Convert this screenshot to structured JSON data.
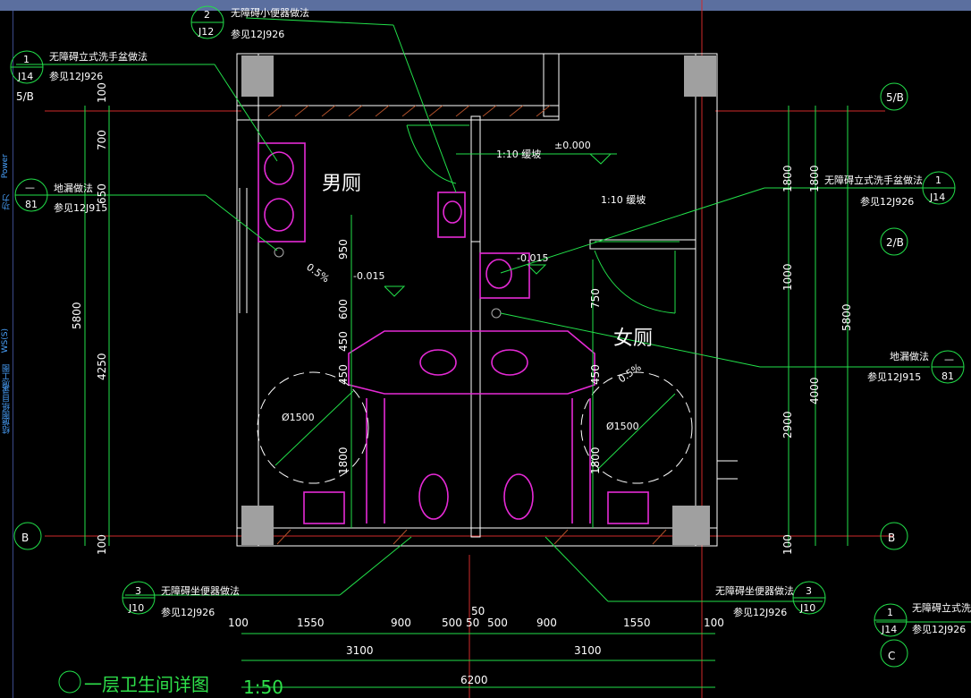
{
  "title": "一层卫生间详图",
  "scale": "1:50",
  "sidebar": {
    "labels": [
      "Power",
      "功力",
      "WS(S)",
      "施工图",
      "图纸目录",
      "结施"
    ]
  },
  "rooms": {
    "men": "男厕",
    "women": "女厕"
  },
  "grid_labels": {
    "left_b": "B",
    "right_b": "B",
    "right_5b_top": "5/B",
    "right_2b": "2/B",
    "right_c": "C",
    "left_5b": "5/B"
  },
  "callouts": {
    "urinal": {
      "num": "2",
      "ref": "J12",
      "title": "无障碍小便器做法",
      "see": "参见12J926"
    },
    "washbasin_left": {
      "num": "1",
      "ref": "J14",
      "title": "无障碍立式洗手盆做法",
      "see": "参见12J926"
    },
    "drain_left": {
      "num": "—",
      "ref": "81",
      "title": "地漏做法",
      "see": "参见12J915"
    },
    "washbasin_right": {
      "num": "1",
      "ref": "J14",
      "title": "无障碍立式洗手盆做法",
      "see": "参见12J926"
    },
    "drain_right": {
      "num": "—",
      "ref": "81",
      "title": "地漏做法",
      "see": "参见12J915"
    },
    "toilet_left": {
      "num": "3",
      "ref": "J10",
      "title": "无障碍坐便器做法",
      "see": "参见12J926"
    },
    "toilet_right": {
      "num": "3",
      "ref": "J10",
      "title": "无障碍坐便器做法",
      "see": "参见12J926"
    },
    "washbasin_bottomright": {
      "num": "1",
      "ref": "J14",
      "title": "无障碍立式洗",
      "see": "参见12J926"
    }
  },
  "annotations": {
    "ramp_1": "1:10  缓坡",
    "ramp_2": "1:10  缓坡",
    "level_0": "±0.000",
    "level_neg1": "-0.015",
    "level_neg2": "-0.015",
    "slope_1": "0.5%",
    "slope_2": "0.5%",
    "circle_1": "Ø1500",
    "circle_2": "Ø1500"
  },
  "dims_bottom_row1": [
    "100",
    "1550",
    "900",
    "500",
    "50",
    "500",
    "900",
    "1550",
    "100"
  ],
  "dims_bottom_extra": "50",
  "dims_bottom_row2": [
    "3100",
    "3100"
  ],
  "dims_bottom_total": "6200",
  "dims_left": [
    "100",
    "700",
    "650",
    "5800",
    "4250",
    "100"
  ],
  "dims_inner_left": [
    "950",
    "600",
    "450",
    "450",
    "1800"
  ],
  "dims_inner_right": [
    "750",
    "450",
    "1800"
  ],
  "dims_right_col1": [
    "1800",
    "1000",
    "2900",
    "100"
  ],
  "dims_right_col2": [
    "1800",
    "4000"
  ],
  "dims_right_col3": [
    "5800"
  ]
}
